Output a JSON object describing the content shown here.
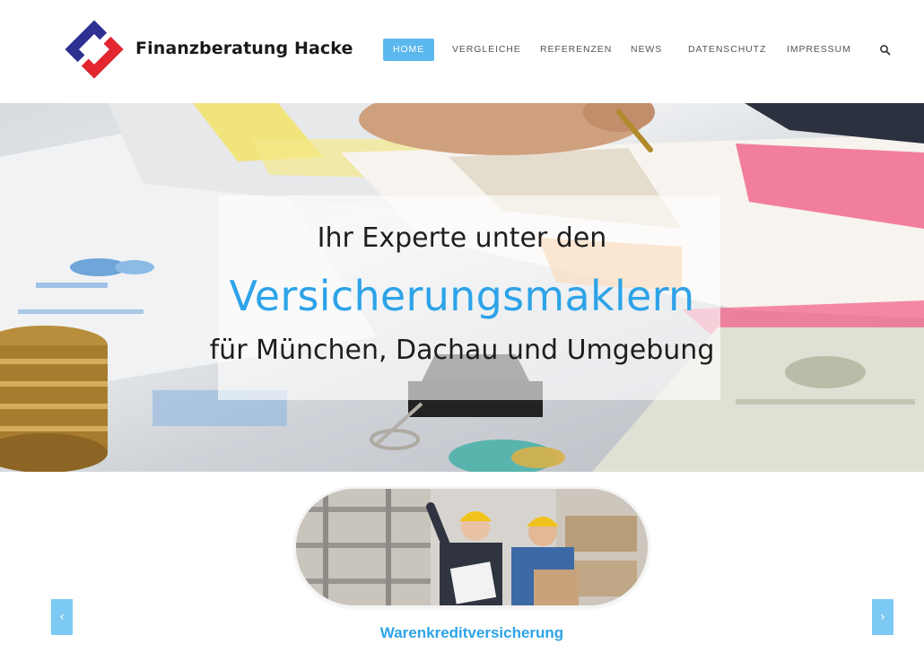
{
  "header": {
    "brand": "Finanzberatung Hacke",
    "logo_icon": "brand-logo-icon",
    "search_icon": "search-icon"
  },
  "nav": {
    "items": [
      {
        "label": "HOME",
        "active": true
      },
      {
        "label": "VERGLEICHE",
        "active": false
      },
      {
        "label": "REFERENZEN",
        "active": false
      },
      {
        "label": "NEWS",
        "active": false
      },
      {
        "label": "DATENSCHUTZ",
        "active": false
      },
      {
        "label": "IMPRESSUM",
        "active": false
      }
    ]
  },
  "hero": {
    "line1": "Ihr Experte unter den",
    "line2": "Versicherungsmaklern",
    "line3": "für München, Dachau und Umgebung"
  },
  "carousel": {
    "title": "Warenkreditversicherung",
    "prev_icon": "chevron-left-icon",
    "next_icon": "chevron-right-icon",
    "prev_glyph": "‹",
    "next_glyph": "›"
  },
  "colors": {
    "accent": "#2da3e8",
    "nav_active": "#5bb8ee",
    "arrow_bg": "#7ccaf3",
    "logo_red": "#e3262f",
    "logo_blue": "#2e3192"
  }
}
